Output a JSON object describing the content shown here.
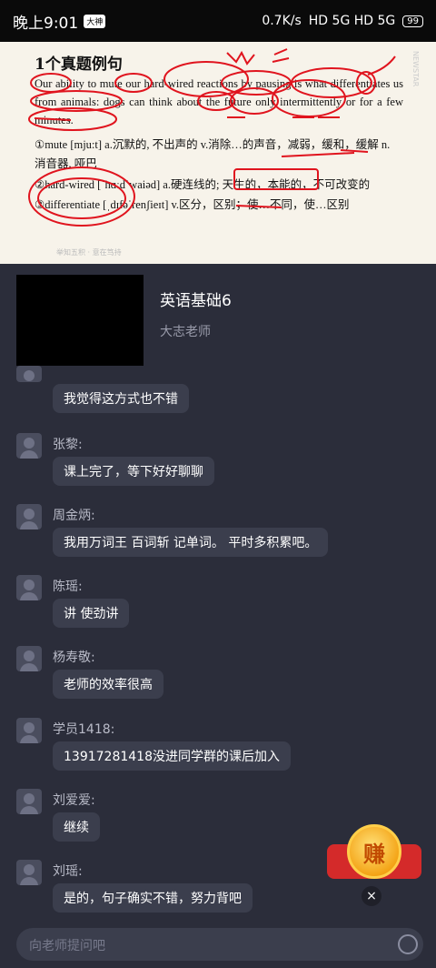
{
  "status_bar": {
    "time": "晚上9:01",
    "app_badge": "大神",
    "speed": "0.7K/s",
    "signal": "HD 5G HD 5G",
    "battery": "99"
  },
  "slide": {
    "heading": "1个真题例句",
    "sentence": "Our ability to mute our hard-wired reactions by pausing is what differentiates us from animals: dogs can think about the future only intermittently or for a few minutes.",
    "vocab1": "①mute [mju:t] a.沉默的, 不出声的 v.消除…的声音，减弱，缓和，缓解 n.",
    "vocab1b": "消音器, 哑巴",
    "vocab2": "②hard-wired [ˈhɑːdˈwaiəd] a.硬连线的; 天生的，本能的，不可改变的",
    "vocab3": "③differentiate [ˌdɪfəˈrenʃieɪt] v.区分，区别；使…不同，使…区别",
    "footer": "举知五积 · 意在笃持",
    "side_text": "NEWSTAR"
  },
  "course": {
    "title": "英语基础6",
    "teacher": "大志老师"
  },
  "messages": [
    {
      "user": "",
      "text": "我觉得这方式也不错"
    },
    {
      "user": "张黎:",
      "text": "课上完了，等下好好聊聊"
    },
    {
      "user": "周金炳:",
      "text": "我用万词王 百词斩 记单词。 平时多积累吧。"
    },
    {
      "user": "陈瑶:",
      "text": "讲  使劲讲"
    },
    {
      "user": "杨寿敬:",
      "text": "老师的效率很高"
    },
    {
      "user": "学员1418:",
      "text": "13917281418没进同学群的课后加入"
    },
    {
      "user": "刘爱爱:",
      "text": "继续"
    },
    {
      "user": "刘瑶:",
      "text": "是的，句子确实不错，努力背吧"
    }
  ],
  "earn_button": "赚",
  "close_icon": "×",
  "input": {
    "placeholder": "向老师提问吧"
  },
  "colors": {
    "background": "#2b2d3a",
    "bubble": "#3b3e4d",
    "ink": "#e0141e",
    "earn": "#f4a417"
  }
}
